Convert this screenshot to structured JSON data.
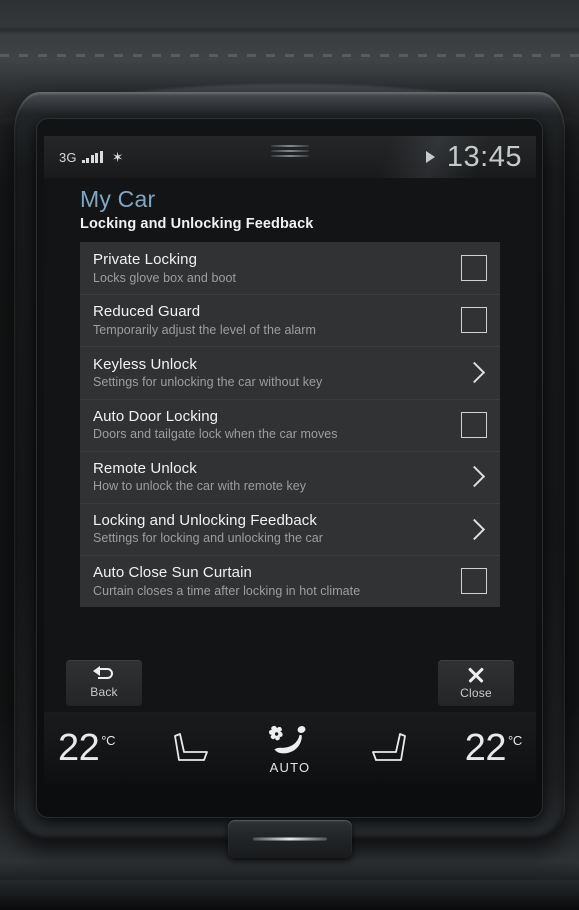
{
  "statusbar": {
    "network": "3G",
    "signal_bars": 5,
    "bluetooth_icon": "bluetooth-icon",
    "media_play_icon": "play-icon",
    "clock": "13:45"
  },
  "header": {
    "title": "My Car",
    "subtitle": "Locking and Unlocking Feedback",
    "title_color": "#7ea7c4"
  },
  "list": {
    "rows": [
      {
        "title": "Private Locking",
        "subtitle": "Locks glove box and boot",
        "control": "checkbox",
        "checked": false
      },
      {
        "title": "Reduced Guard",
        "subtitle": "Temporarily adjust the level of the alarm",
        "control": "checkbox",
        "checked": false
      },
      {
        "title": "Keyless Unlock",
        "subtitle": "Settings for unlocking the car without key",
        "control": "chevron",
        "checked": false
      },
      {
        "title": "Auto Door Locking",
        "subtitle": "Doors and tailgate lock when the car moves",
        "control": "checkbox",
        "checked": false
      },
      {
        "title": "Remote Unlock",
        "subtitle": "How to unlock the car with remote key",
        "control": "chevron",
        "checked": false
      },
      {
        "title": "Locking and Unlocking Feedback",
        "subtitle": "Settings for locking and unlocking the car",
        "control": "chevron",
        "checked": false
      },
      {
        "title": "Auto Close Sun Curtain",
        "subtitle": "Curtain closes a time after locking in hot climate",
        "control": "checkbox",
        "checked": false
      }
    ]
  },
  "actions": {
    "back_label": "Back",
    "back_icon": "back-arrow-icon",
    "close_label": "Close",
    "close_icon": "close-x-icon"
  },
  "climate": {
    "left_temp_value": "22",
    "left_temp_unit": "°C",
    "left_seat_icon": "driver-seat-icon",
    "fan_icon": "fan-airflow-icon",
    "auto_label": "AUTO",
    "right_seat_icon": "passenger-seat-icon",
    "right_temp_value": "22",
    "right_temp_unit": "°C"
  },
  "hardware": {
    "home_button": "home-button"
  }
}
